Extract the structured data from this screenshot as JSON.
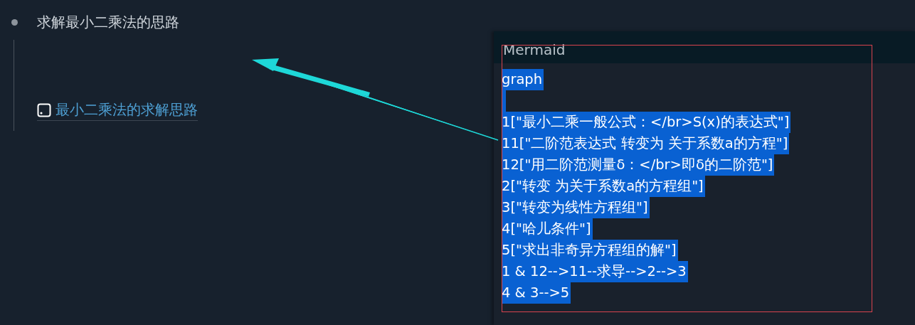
{
  "outline": {
    "heading": "求解最小二乘法的思路",
    "link": {
      "text": "最小二乘法的求解思路"
    }
  },
  "panel": {
    "title": "Mermaid",
    "framed": true,
    "lines": [
      {
        "text": "graph",
        "selected": true
      },
      {
        "selected": true
      },
      {
        "text": "1[\"最小二乘一般公式：</br>S(x)的表达式\"]",
        "selected": true
      },
      {
        "text": "11[\"二阶范表达式 转变为 关于系数a的方程\"]",
        "selected": true
      },
      {
        "text": "12[\"用二阶范测量δ：</br>即δ的二阶范\"]",
        "selected": true
      },
      {
        "text": "2[\"转变 为关于系数a的方程组\"]",
        "selected": true
      },
      {
        "text": "3[\"转变为线性方程组\"]",
        "selected": true
      },
      {
        "text": "4[\"哈儿条件\"]",
        "selected": true
      },
      {
        "text": "5[\"求出非奇异方程组的解\"]",
        "selected": true
      },
      {
        "text": "1 & 12-->11--求导-->2-->3",
        "selected": true
      },
      {
        "text": "4 & 3-->5",
        "selected": true
      }
    ]
  }
}
